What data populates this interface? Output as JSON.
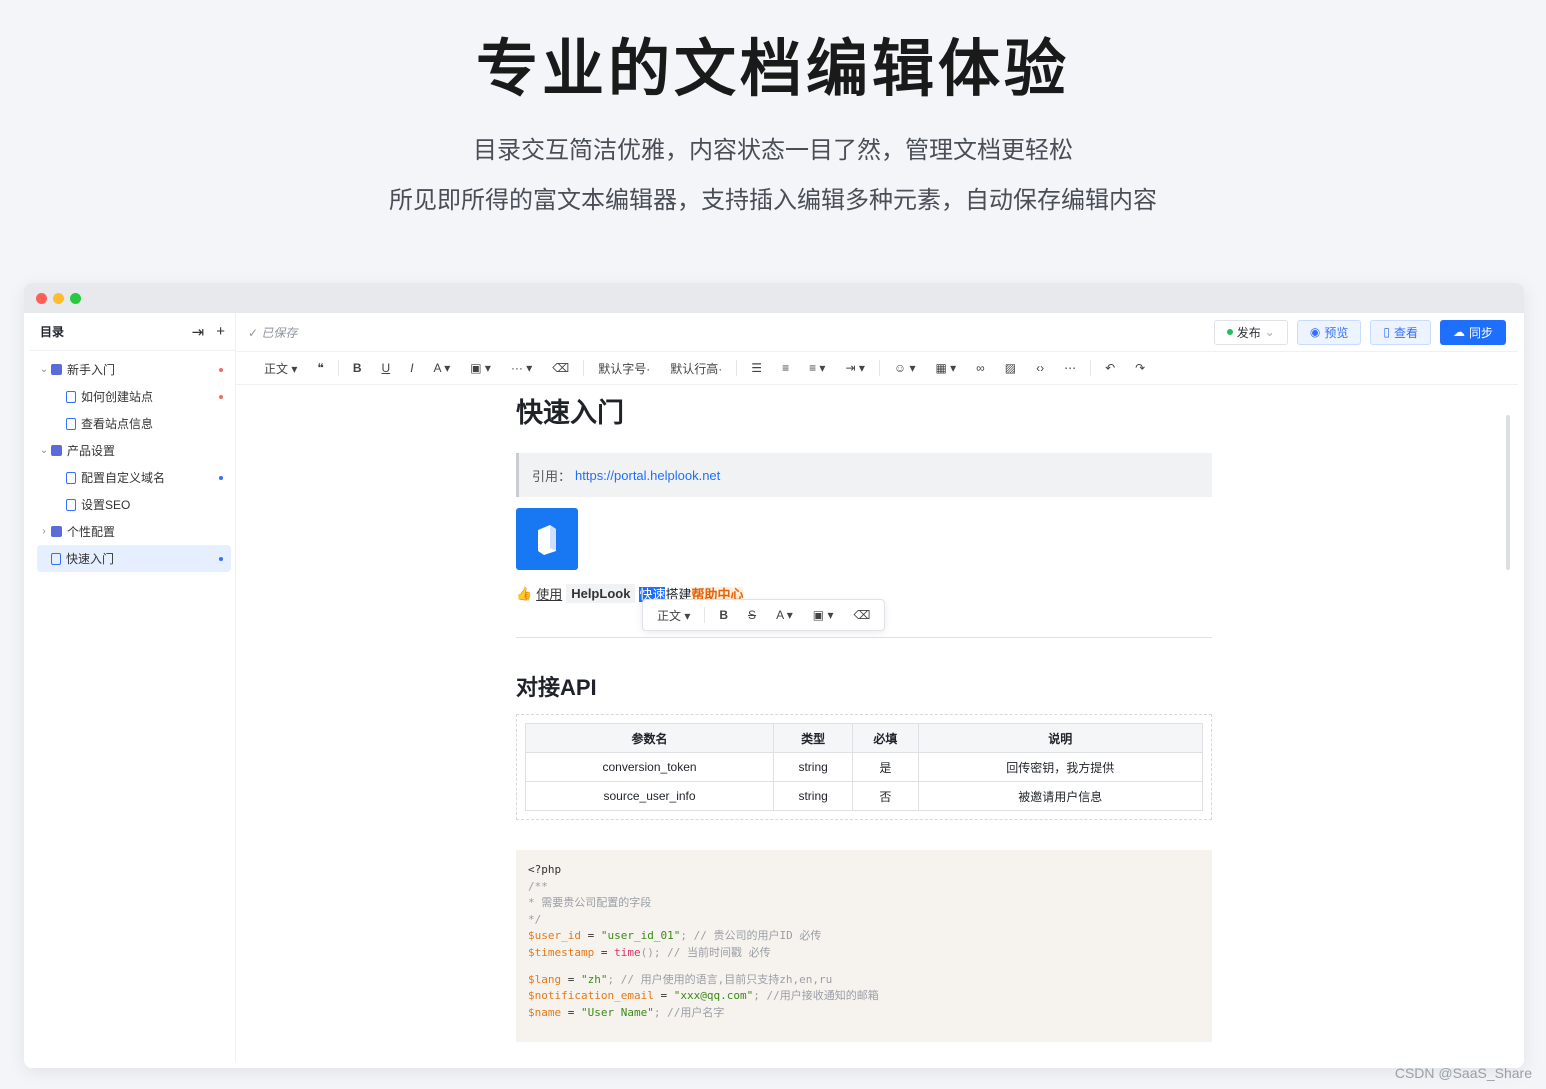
{
  "hero": {
    "title": "专业的文档编辑体验",
    "subtitle1": "目录交互简洁优雅，内容状态一目了然，管理文档更轻松",
    "subtitle2": "所见即所得的富文本编辑器，支持插入编辑多种元素，自动保存编辑内容"
  },
  "colors": {
    "accent": "#1f6fff",
    "red_dot": "#ff5f57",
    "yellow_dot": "#febc2e",
    "green_dot": "#28c840"
  },
  "sidebar": {
    "title": "目录",
    "collapse_icon": "collapse-icon",
    "add_icon": "plus-icon",
    "items": [
      {
        "label": "新手入门",
        "level": 0,
        "kind": "book",
        "arrow": "⌄",
        "dot": "#f26b6b"
      },
      {
        "label": "如何创建站点",
        "level": 1,
        "kind": "doc",
        "arrow": "",
        "dot": "#f26b6b"
      },
      {
        "label": "查看站点信息",
        "level": 1,
        "kind": "doc",
        "arrow": "",
        "dot": ""
      },
      {
        "label": "产品设置",
        "level": 0,
        "kind": "book",
        "arrow": "⌄",
        "dot": ""
      },
      {
        "label": "配置自定义域名",
        "level": 1,
        "kind": "doc",
        "arrow": "",
        "dot": "#3370ff"
      },
      {
        "label": "设置SEO",
        "level": 1,
        "kind": "doc",
        "arrow": "",
        "dot": ""
      },
      {
        "label": "个性配置",
        "level": 0,
        "kind": "book",
        "arrow": "›",
        "dot": ""
      },
      {
        "label": "快速入门",
        "level": 0,
        "kind": "doc",
        "arrow": "",
        "dot": "#3370ff",
        "active": true
      }
    ]
  },
  "topbar": {
    "saved": "已保存",
    "publish": "发布",
    "preview": "预览",
    "view": "查看",
    "sync": "同步"
  },
  "toolbar": {
    "paragraph": "正文",
    "font_size": "默认字号",
    "line_height": "默认行高"
  },
  "doc": {
    "title": "快速入门",
    "quote_label": "引用：",
    "quote_link": "https://portal.helplook.net",
    "line": {
      "p1": "使用",
      "chip": "HelpLook",
      "sel": "快速",
      "p2": "搭建",
      "hl": "帮助中心"
    },
    "float_paragraph": "正文",
    "h2": "对接API",
    "table": {
      "headers": [
        "参数名",
        "类型",
        "必填",
        "说明"
      ],
      "rows": [
        [
          "conversion_token",
          "string",
          "是",
          "回传密钥，我方提供"
        ],
        [
          "source_user_info",
          "string",
          "否",
          "被邀请用户信息"
        ]
      ]
    },
    "code": {
      "l1": "<?php",
      "l2": "/**",
      "l3": " *  需要贵公司配置的字段",
      "l4": " */",
      "l5a": "$user_id",
      "l5b": " = ",
      "l5c": "\"user_id_01\"",
      "l5d": ";    // 贵公司的用户ID   必传",
      "l6a": "$timestamp",
      "l6b": " = ",
      "l6c": "time",
      "l6d": "();       // 当前时间戳       必传",
      "l7a": "$lang",
      "l7b": " = ",
      "l7c": "\"zh\"",
      "l7d": ";              // 用户使用的语言,目前只支持zh,en,ru",
      "l8a": "$notification_email",
      "l8b": " = ",
      "l8c": "\"xxx@qq.com\"",
      "l8d": ";   //用户接收通知的邮箱",
      "l9a": "$name",
      "l9b": " = ",
      "l9c": "\"User Name\"",
      "l9d": ";   //用户名字"
    }
  },
  "watermark": "CSDN @SaaS_Share"
}
